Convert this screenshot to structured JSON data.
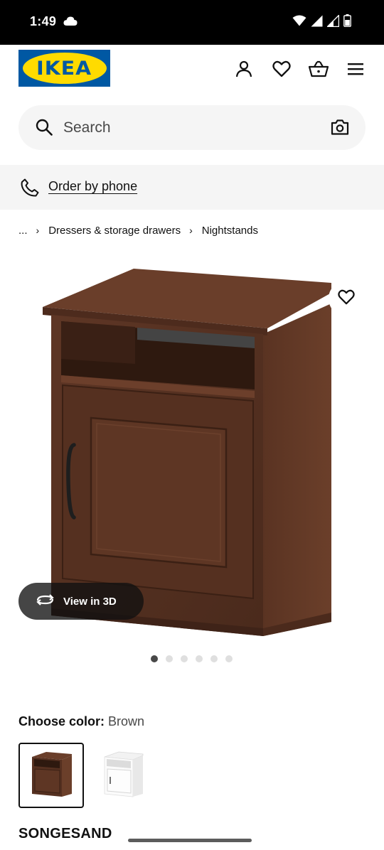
{
  "status_bar": {
    "time": "1:49"
  },
  "header": {
    "logo_text": "IKEA"
  },
  "search": {
    "placeholder": "Search"
  },
  "phone": {
    "label": "Order by phone"
  },
  "breadcrumb": {
    "ellipsis": "...",
    "items": [
      "Dressers & storage drawers",
      "Nightstands"
    ]
  },
  "product": {
    "view_3d_label": "View in 3D",
    "image_count": 6,
    "active_image": 1,
    "name": "SONGESAND"
  },
  "color": {
    "label": "Choose color:",
    "value": "Brown",
    "options": [
      "Brown",
      "White"
    ],
    "selected": "Brown"
  },
  "colors": {
    "ikea_blue": "#0058a3",
    "ikea_yellow": "#ffdb00",
    "wood_brown": "#5a3424"
  }
}
